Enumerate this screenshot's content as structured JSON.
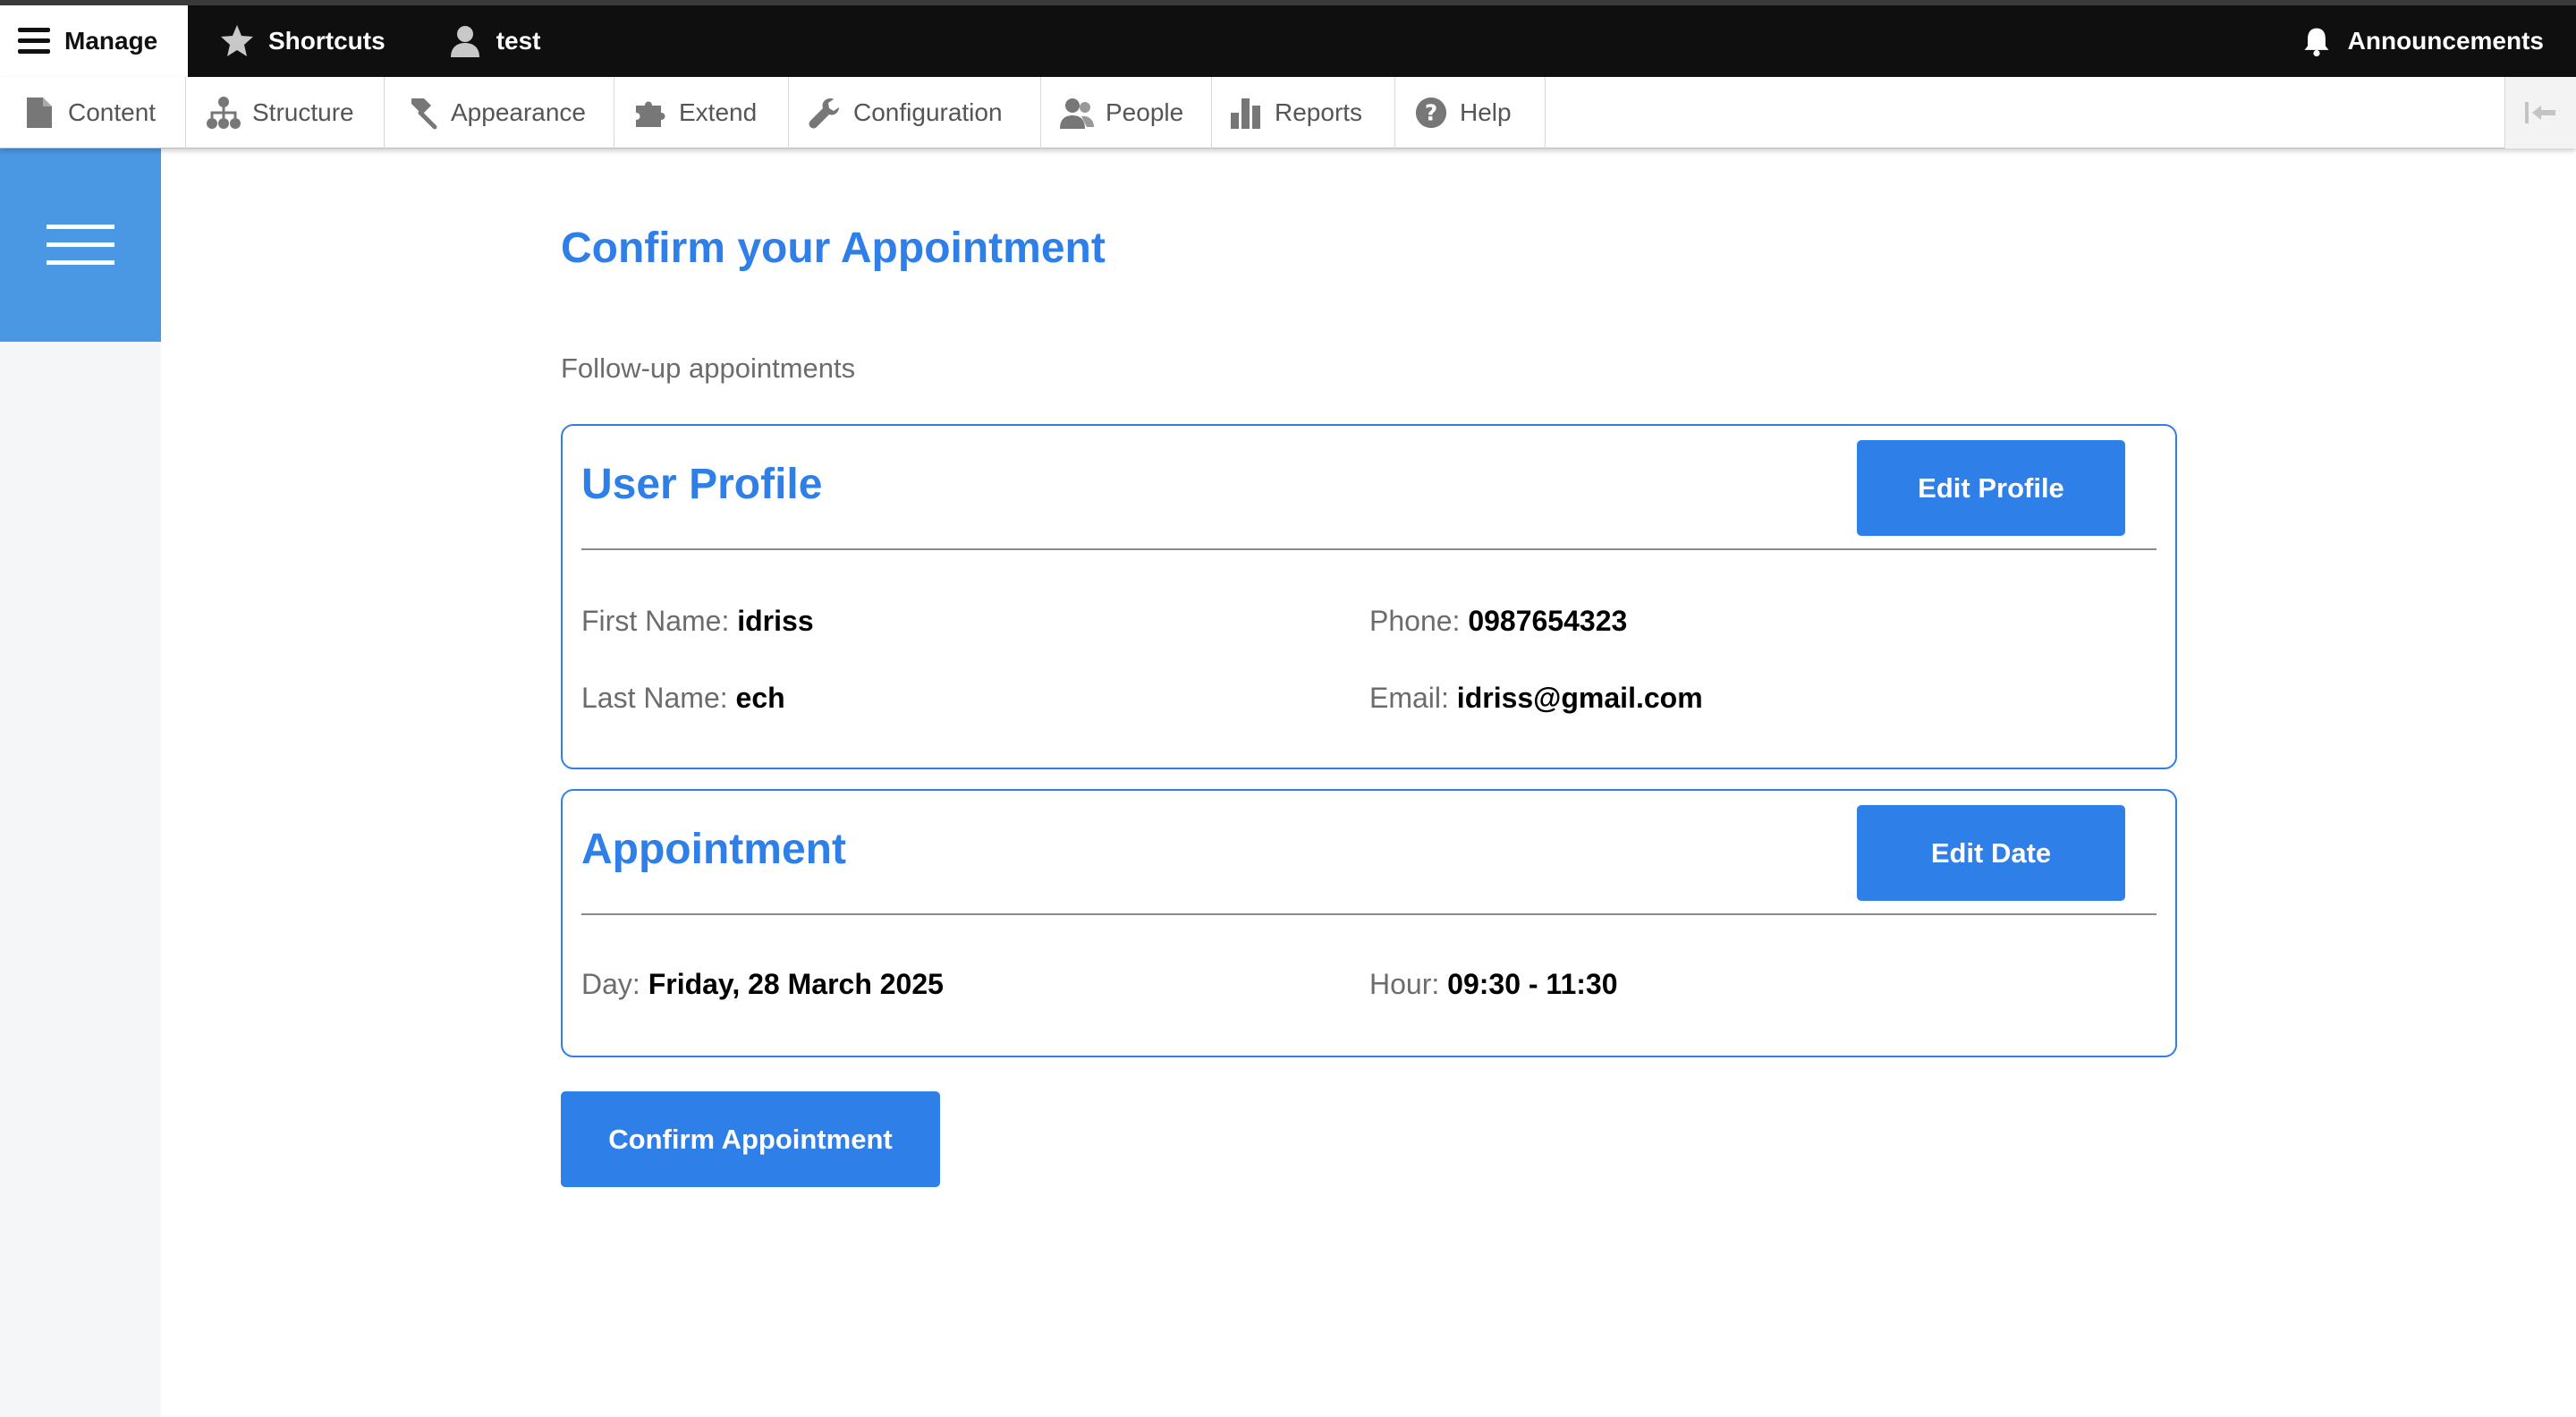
{
  "topbar": {
    "manage_label": "Manage",
    "shortcuts_label": "Shortcuts",
    "user_label": "test",
    "announcements_label": "Announcements"
  },
  "toolbar": {
    "items": [
      {
        "label": "Content",
        "icon": "content-icon"
      },
      {
        "label": "Structure",
        "icon": "structure-icon"
      },
      {
        "label": "Appearance",
        "icon": "appearance-icon"
      },
      {
        "label": "Extend",
        "icon": "extend-icon"
      },
      {
        "label": "Configuration",
        "icon": "configuration-icon"
      },
      {
        "label": "People",
        "icon": "people-icon"
      },
      {
        "label": "Reports",
        "icon": "reports-icon"
      },
      {
        "label": "Help",
        "icon": "help-icon"
      }
    ]
  },
  "page": {
    "title": "Confirm your Appointment",
    "subtitle": "Follow-up appointments"
  },
  "profile": {
    "title": "User Profile",
    "edit_label": "Edit Profile",
    "first_name_label": "First Name:",
    "first_name": "idriss",
    "last_name_label": "Last Name:",
    "last_name": "ech",
    "phone_label": "Phone:",
    "phone": "0987654323",
    "email_label": "Email:",
    "email": "idriss@gmail.com"
  },
  "appointment": {
    "title": "Appointment",
    "edit_label": "Edit Date",
    "day_label": "Day:",
    "day": "Friday, 28 March 2025",
    "hour_label": "Hour:",
    "hour": "09:30 - 11:30"
  },
  "confirm_label": "Confirm Appointment",
  "colors": {
    "accent": "#2e7fe8",
    "sidebar_toggle": "#4a97e3",
    "topbar": "#0f0f0f"
  }
}
